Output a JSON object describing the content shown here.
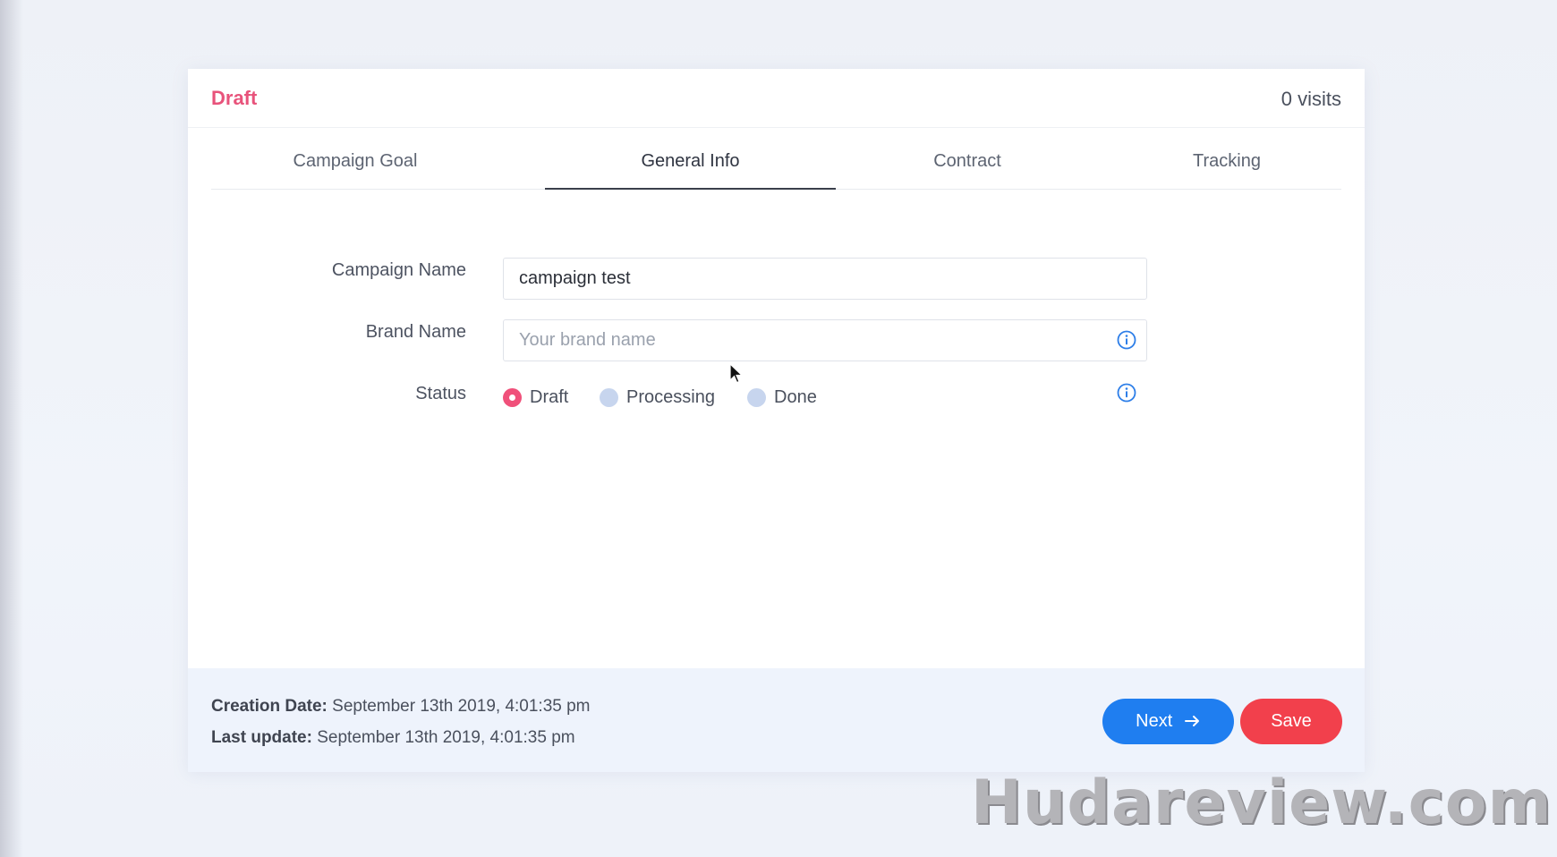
{
  "header": {
    "status": "Draft",
    "visits": "0 visits"
  },
  "tabs": [
    {
      "label": "Campaign Goal",
      "active": false
    },
    {
      "label": "General Info",
      "active": true
    },
    {
      "label": "Contract",
      "active": false
    },
    {
      "label": "Tracking",
      "active": false
    }
  ],
  "form": {
    "campaign_name": {
      "label": "Campaign Name",
      "value": "campaign test"
    },
    "brand_name": {
      "label": "Brand Name",
      "placeholder": "Your brand name",
      "icon": "info-icon"
    },
    "status": {
      "label": "Status",
      "icon": "info-icon",
      "options": [
        {
          "label": "Draft",
          "checked": true
        },
        {
          "label": "Processing",
          "checked": false
        },
        {
          "label": "Done",
          "checked": false
        }
      ]
    }
  },
  "footer": {
    "creation_label": "Creation Date:",
    "creation_value": "September 13th 2019, 4:01:35 pm",
    "update_label": "Last update:",
    "update_value": "September 13th 2019, 4:01:35 pm",
    "next_label": "Next",
    "next_icon": "arrow-right-icon",
    "save_label": "Save"
  },
  "watermark": "Hudareview.com",
  "colors": {
    "status_accent": "#e8537b",
    "primary_button": "#1f7ef0",
    "save_button": "#f2404c",
    "info_icon": "#2d7ee8",
    "radio_checked": "#f0507a",
    "radio_unchecked": "#c7d5ee"
  }
}
